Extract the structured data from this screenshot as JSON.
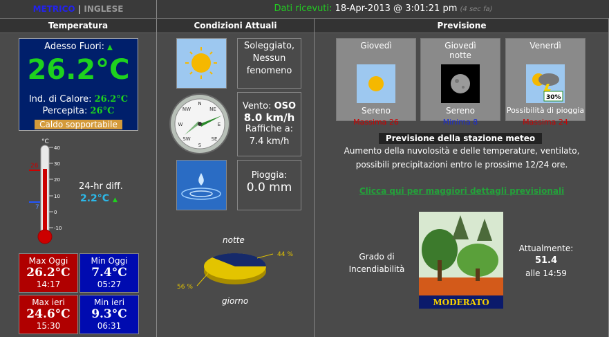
{
  "lang": {
    "metric": "METRICO",
    "sep": "|",
    "english": "INGLESE"
  },
  "received": {
    "label": "Dati ricevuti:",
    "value": "18-Apr-2013 @ 3:01:21 pm",
    "ago": "(4 sec fa)"
  },
  "columns": {
    "temperature": "Temperatura",
    "current": "Condizioni Attuali",
    "forecast": "Previsione"
  },
  "temp": {
    "outside_label": "Adesso Fuori:",
    "outside_value": "26.2°C",
    "heat_label": "Ind. di Calore:",
    "heat_value": "26.2°C",
    "feels_label": "Percepita:",
    "feels_value": "26°C",
    "comfort": "Caldo sopportabile",
    "diff_label": "24-hr diff.",
    "diff_value": "2.2°C",
    "thermo_unit": "°C",
    "thermo_ticks": [
      "40",
      "30",
      "20",
      "10",
      "0",
      "-10"
    ],
    "marker_high": "26",
    "marker_low": "7",
    "max_today_label": "Max Oggi",
    "max_today_value": "26.2°C",
    "max_today_time": "14:17",
    "min_today_label": "Min Oggi",
    "min_today_value": "7.4°C",
    "min_today_time": "05:27",
    "max_yest_label": "Max ieri",
    "max_yest_value": "24.6°C",
    "max_yest_time": "15:30",
    "min_yest_label": "Min ieri",
    "min_yest_value": "9.3°C",
    "min_yest_time": "06:31"
  },
  "current": {
    "sky_line1": "Soleggiato,",
    "sky_line2": "Nessun",
    "sky_line3": "fenomeno",
    "wind_label": "Vento:",
    "wind_dir": "OSO",
    "wind_speed": "8.0 km/h",
    "gust_label": "Raffiche a:",
    "gust_value": "7.4 km/h",
    "rain_label": "Pioggia:",
    "rain_value": "0.0 mm",
    "compass": [
      "N",
      "NE",
      "E",
      "SE",
      "S",
      "SW",
      "W",
      "NW"
    ],
    "pie_top": "notte",
    "pie_bottom": "giorno",
    "pie_night_pct": "44 %",
    "pie_day_pct": "56 %",
    "pie_night_value": 44,
    "pie_day_value": 56
  },
  "forecast": {
    "days": [
      {
        "day": "Giovedì",
        "sub": "",
        "cond": "Sereno",
        "temp": "Massima 26",
        "tone": "red",
        "icon": "sun-icon"
      },
      {
        "day": "Giovedì",
        "sub": "notte",
        "cond": "Sereno",
        "temp": "Minima 8",
        "tone": "blue",
        "icon": "moon-icon"
      },
      {
        "day": "Venerdì",
        "sub": "",
        "cond": "Possibilità di pioggia",
        "temp": "Massima 24",
        "tone": "red",
        "icon": "storm-icon",
        "pct": "30%"
      }
    ],
    "station_title": "Previsione della stazione meteo",
    "station_text1": "Aumento della nuvolosità e delle temperature, ventilato,",
    "station_text2": "possibili precipitazioni entro le prossime 12/24 ore.",
    "link": "Clicca qui per maggiori dettagli previsionali",
    "fire_label1": "Grado di",
    "fire_label2": "Incendiabilità",
    "fire_badge": "MODERATO",
    "now_label": "Attualmente:",
    "now_value": "51.4",
    "now_time": "alle 14:59"
  },
  "colors": {
    "accent_green": "#1ed21e",
    "temp_blue": "#001f6b",
    "max_red": "#b00000",
    "min_blue": "#000bb0"
  }
}
